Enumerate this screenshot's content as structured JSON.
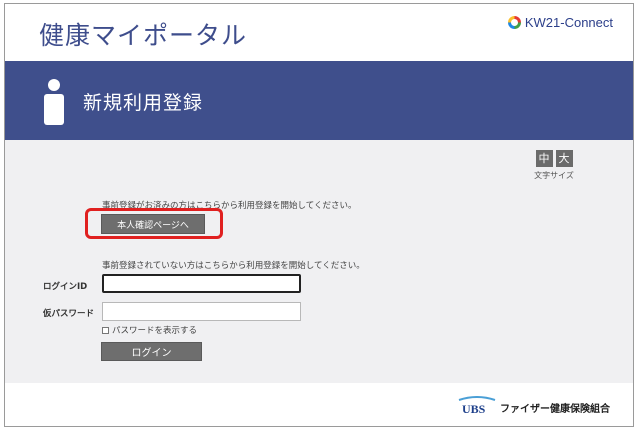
{
  "header": {
    "title": "健康マイポータル",
    "partner_logo_text": "KW21-Connect"
  },
  "banner": {
    "title": "新規利用登録"
  },
  "font_size": {
    "medium": "中",
    "large": "大",
    "label": "文字サイズ"
  },
  "pre_registered": {
    "message": "事前登録がお済みの方はこちらから利用登録を開始してください。",
    "button": "本人確認ページへ"
  },
  "not_registered": {
    "message": "事前登録されていない方はこちらから利用登録を開始してください。"
  },
  "login_form": {
    "id_label": "ログインID",
    "id_value": "",
    "password_label": "仮パスワード",
    "password_value": "",
    "show_password_label": "パスワードを表示する",
    "show_password_checked": false,
    "submit": "ログイン"
  },
  "footer": {
    "logo_text": "UBS",
    "organization": "ファイザー健康保険組合"
  },
  "colors": {
    "brand_blue": "#3f4f8c",
    "button_gray": "#6e6e6e",
    "highlight_red": "#e02020",
    "content_bg": "#f0f0f2"
  }
}
